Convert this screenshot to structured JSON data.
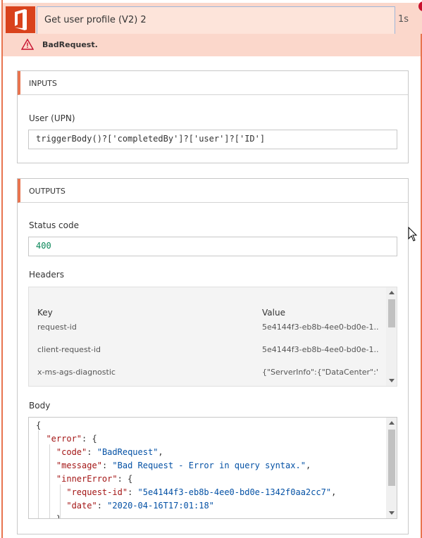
{
  "header": {
    "title": "Get user profile (V2) 2",
    "duration": "1s",
    "icon": "office-icon",
    "accent": "#e8744f",
    "brand_color": "#d9421c"
  },
  "error": {
    "message": "BadRequest.",
    "icon": "warning-triangle-icon"
  },
  "inputs": {
    "section_title": "INPUTS",
    "user_label": "User (UPN)",
    "user_value": "triggerBody()?['completedBy']?['user']?['ID']"
  },
  "outputs": {
    "section_title": "OUTPUTS",
    "status_label": "Status code",
    "status_value": "400",
    "headers_label": "Headers",
    "headers_columns": [
      "Key",
      "Value"
    ],
    "headers_rows": [
      {
        "key": "request-id",
        "value": "5e4144f3-eb8b-4ee0-bd0e-1..."
      },
      {
        "key": "client-request-id",
        "value": "5e4144f3-eb8b-4ee0-bd0e-1..."
      },
      {
        "key": "x-ms-ags-diagnostic",
        "value": "{\"ServerInfo\":{\"DataCenter\":\"S..."
      }
    ],
    "body_label": "Body",
    "body_json": {
      "error_key": "\"error\"",
      "code_key": "\"code\"",
      "code_val": "\"BadRequest\"",
      "message_key": "\"message\"",
      "message_val": "\"Bad Request - Error in query syntax.\"",
      "inner_key": "\"innerError\"",
      "request_id_key": "\"request-id\"",
      "request_id_val": "\"5e4144f3-eb8b-4ee0-bd0e-1342f0aa2cc7\"",
      "date_key": "\"date\"",
      "date_val": "\"2020-04-16T17:01:18\""
    }
  }
}
